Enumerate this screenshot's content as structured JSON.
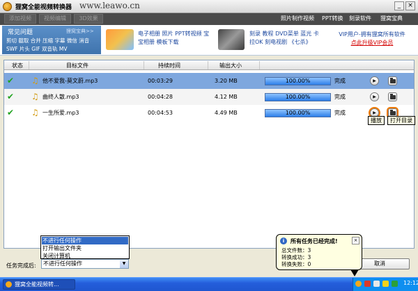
{
  "window": {
    "title": "狸窝全能视频转换器",
    "site": "www.leawo.cn",
    "minimize": "_",
    "close": "×"
  },
  "toolbar": {
    "add_video": "添加视频",
    "edit_video": "视频编辑",
    "three_d": "3D效果"
  },
  "menu": {
    "items": [
      "照片制作视频",
      "PPT转换",
      "刻录软件",
      "狸窝宝典"
    ]
  },
  "faq": {
    "title": "常见问题",
    "more": "狸窝宝典>>",
    "links": "剪切 截取 合并 压缩 字幕 微信 消音 SWF 片头 GIF 双音轨 MV"
  },
  "promo": {
    "group1": "电子相册 照片 PPT转视频 宝宝相册 模板下载",
    "group2": "刻录 教程 DVD菜单 蓝光 卡拉OK 刻电视剧 《七杀》",
    "vip_line": "VIP用户-拥有狸窝所有软件",
    "vip_link": "点此升级VIP会员"
  },
  "table": {
    "columns": [
      "状态",
      "目标文件",
      "持续时间",
      "输出大小"
    ],
    "rows": [
      {
        "file": "他不爱我-莫文蔚.mp3",
        "duration": "00:03:29",
        "size": "3.20 MB",
        "progress": "100.00%",
        "status": "完成"
      },
      {
        "file": "曲终人散.mp3",
        "duration": "00:04:28",
        "size": "4.12 MB",
        "progress": "100.00%",
        "status": "完成"
      },
      {
        "file": "一生所爱.mp3",
        "duration": "00:04:53",
        "size": "4.49 MB",
        "progress": "100.00%",
        "status": "完成"
      }
    ],
    "tooltip_play": "播放",
    "tooltip_open": "打开目录"
  },
  "bottom": {
    "after_label": "任务完成后:",
    "after_value": "不进行任何操作",
    "options": [
      "不进行任何操作",
      "打开输出文件夹",
      "关闭计算机"
    ],
    "cancel": "取消"
  },
  "balloon": {
    "title": "所有任务已经完成!",
    "close": "×",
    "total": "总文件数：3",
    "success": "转换成功：3",
    "failed": "转换失败：0"
  },
  "taskbar": {
    "item": "狸窝全能视频转...",
    "clock": "12:12"
  }
}
